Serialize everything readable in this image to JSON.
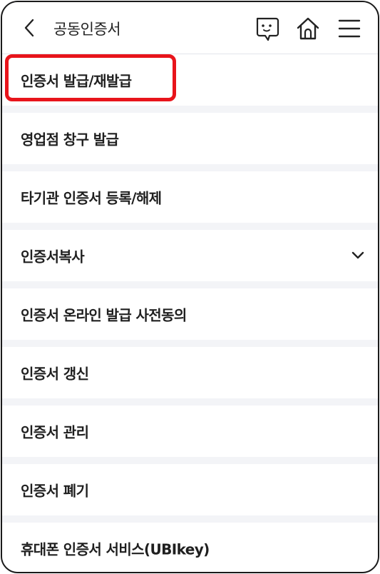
{
  "header": {
    "title": "공동인증서",
    "icons": [
      "back-icon",
      "chat-icon",
      "home-icon",
      "hamburger-icon"
    ]
  },
  "menu": {
    "items": [
      {
        "label": "인증서 발급/재발급",
        "highlighted": true
      },
      {
        "label": "영업점 창구 발급"
      },
      {
        "label": "타기관 인증서 등록/해제"
      },
      {
        "label": "인증서복사",
        "expandable": true
      },
      {
        "label": "인증서 온라인 발급 사전동의"
      },
      {
        "label": "인증서 갱신"
      },
      {
        "label": "인증서 관리"
      },
      {
        "label": "인증서 폐기"
      },
      {
        "label": "휴대폰 인증서 서비스(UBIkey)"
      }
    ]
  },
  "colors": {
    "highlight": "#e8141b",
    "separator": "#f3f4f7",
    "text": "#1f1f1f"
  }
}
